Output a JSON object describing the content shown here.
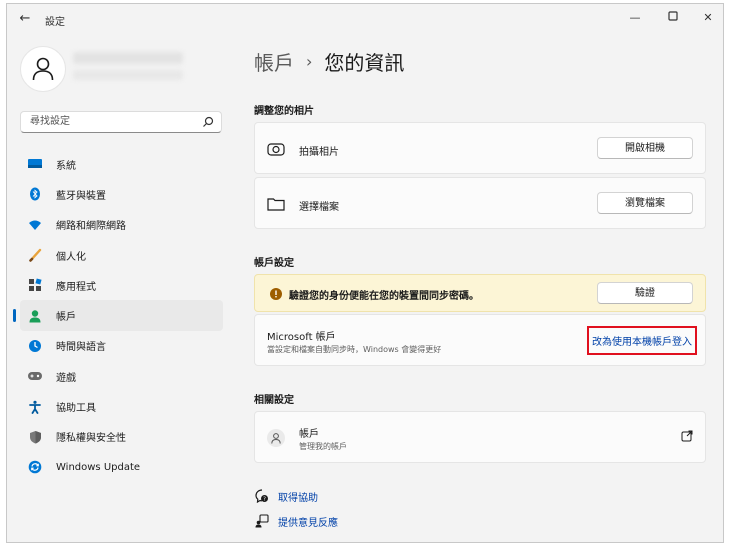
{
  "window": {
    "app_title": "設定",
    "back_icon": "back-arrow-icon",
    "controls": [
      "minimize-icon",
      "maximize-icon",
      "close-icon"
    ]
  },
  "search": {
    "placeholder": "尋找設定"
  },
  "sidebar": {
    "items": [
      {
        "label": "系統",
        "icon": "system-icon"
      },
      {
        "label": "藍牙與裝置",
        "icon": "bluetooth-icon"
      },
      {
        "label": "網路和網際網路",
        "icon": "network-icon"
      },
      {
        "label": "個人化",
        "icon": "personalization-icon"
      },
      {
        "label": "應用程式",
        "icon": "apps-icon"
      },
      {
        "label": "帳戶",
        "icon": "account-icon",
        "selected": true
      },
      {
        "label": "時間與語言",
        "icon": "time-language-icon"
      },
      {
        "label": "遊戲",
        "icon": "gaming-icon"
      },
      {
        "label": "協助工具",
        "icon": "accessibility-icon"
      },
      {
        "label": "隱私權與安全性",
        "icon": "privacy-shield-icon"
      },
      {
        "label": "Windows Update",
        "icon": "windows-update-icon"
      }
    ]
  },
  "breadcrumb": {
    "parent": "帳戶",
    "separator": "›",
    "current": "您的資訊"
  },
  "photo_section": {
    "title": "調整您的相片",
    "take_photo": {
      "label": "拍攝相片",
      "button": "開啟相機",
      "icon": "camera-icon"
    },
    "choose_file": {
      "label": "選擇檔案",
      "button": "瀏覽檔案",
      "icon": "folder-icon"
    }
  },
  "account_section": {
    "title": "帳戶設定",
    "warning": {
      "text": "驗證您的身份便能在您的裝置間同步密碼。",
      "button": "驗證",
      "icon": "warning-icon"
    },
    "microsoft": {
      "title": "Microsoft 帳戶",
      "subtitle": "當設定和檔案自動同步時，Windows 會變得更好",
      "link": "改為使用本機帳戶登入"
    }
  },
  "related_section": {
    "title": "相關設定",
    "account": {
      "title": "帳戶",
      "subtitle": "管理我的帳戶",
      "icon": "person-icon",
      "action_icon": "open-external-icon"
    }
  },
  "help_links": [
    {
      "label": "取得協助",
      "icon": "help-icon"
    },
    {
      "label": "提供意見反應",
      "icon": "feedback-icon"
    }
  ],
  "colors": {
    "accent": "#0067c0",
    "link": "#0040a8",
    "warning": "#9d5d00",
    "highlight_border": "#e0101e"
  }
}
